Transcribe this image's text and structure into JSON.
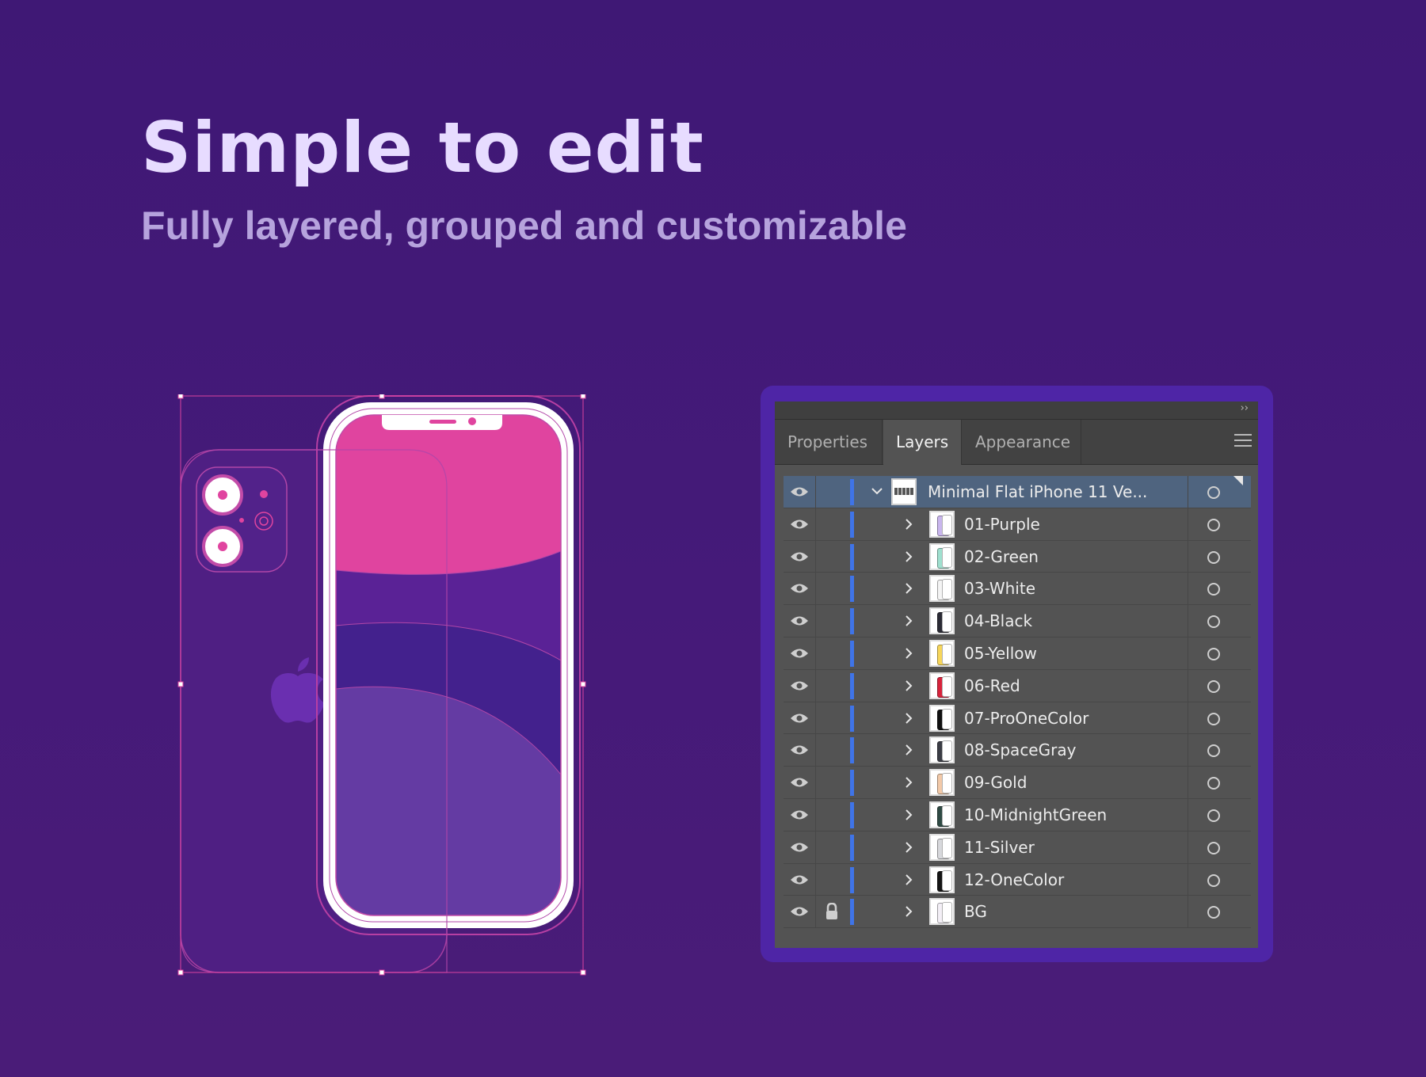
{
  "heading": {
    "title": "Simple to edit",
    "subtitle": "Fully layered, grouped and customizable"
  },
  "colors": {
    "background": "#421a77",
    "accent_pink": "#e0449f",
    "selection_blue": "#3f74e8",
    "panel_bg": "#535353"
  },
  "panel": {
    "tabs": [
      {
        "label": "Properties",
        "active": false
      },
      {
        "label": "Layers",
        "active": true
      },
      {
        "label": "Appearance",
        "active": false
      }
    ],
    "root_layer": {
      "label": "Minimal Flat iPhone 11 Ve..."
    },
    "layers": [
      {
        "label": "01-Purple",
        "color": "#c9b6ee"
      },
      {
        "label": "02-Green",
        "color": "#9fe0cf"
      },
      {
        "label": "03-White",
        "color": "#f4f4f4"
      },
      {
        "label": "04-Black",
        "color": "#2b2b35"
      },
      {
        "label": "05-Yellow",
        "color": "#f7d65a"
      },
      {
        "label": "06-Red",
        "color": "#d8233c"
      },
      {
        "label": "07-ProOneColor",
        "color": "#111111"
      },
      {
        "label": "08-SpaceGray",
        "color": "#3b3d45"
      },
      {
        "label": "09-Gold",
        "color": "#f2c9a8"
      },
      {
        "label": "10-MidnightGreen",
        "color": "#2f4a44"
      },
      {
        "label": "11-Silver",
        "color": "#d7d8dc"
      },
      {
        "label": "12-OneColor",
        "color": "#151515"
      },
      {
        "label": "BG",
        "color": "#f3eff6"
      }
    ]
  }
}
